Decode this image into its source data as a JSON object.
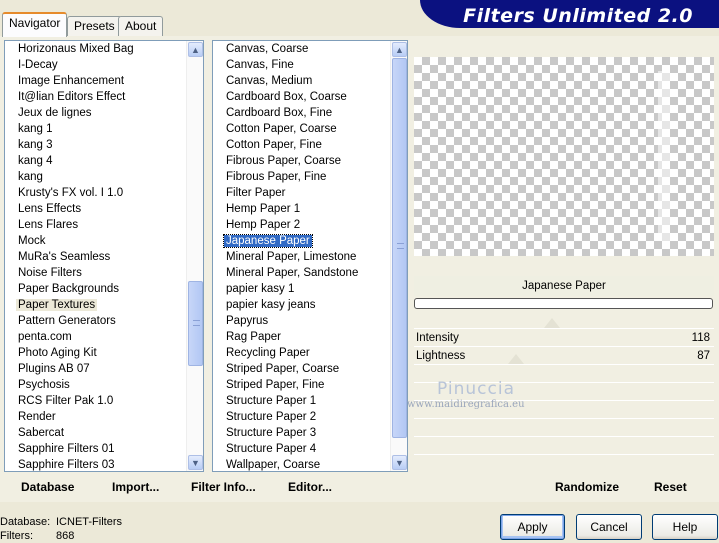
{
  "tabs": [
    "Navigator",
    "Presets",
    "About"
  ],
  "banner_title": "Filters Unlimited 2.0",
  "categories": [
    "Horizonaus Mixed Bag",
    "I-Decay",
    "Image Enhancement",
    "It@lian Editors Effect",
    "Jeux de lignes",
    "kang 1",
    "kang 3",
    "kang 4",
    "kang",
    "Krusty's FX vol. I 1.0",
    "Lens Effects",
    "Lens Flares",
    "Mock",
    "MuRa's Seamless",
    "Noise Filters",
    "Paper Backgrounds",
    "Paper Textures",
    "Pattern Generators",
    "penta.com",
    "Photo Aging Kit",
    "Plugins AB 07",
    "Psychosis",
    "RCS Filter Pak 1.0",
    "Render",
    "Sabercat",
    "Sapphire Filters 01",
    "Sapphire Filters 03"
  ],
  "selected_category": "Paper Textures",
  "filters": [
    "Canvas, Coarse",
    "Canvas, Fine",
    "Canvas, Medium",
    "Cardboard Box, Coarse",
    "Cardboard Box, Fine",
    "Cotton Paper, Coarse",
    "Cotton Paper, Fine",
    "Fibrous Paper, Coarse",
    "Fibrous Paper, Fine",
    "Filter Paper",
    "Hemp Paper 1",
    "Hemp Paper 2",
    "Japanese Paper",
    "Mineral Paper, Limestone",
    "Mineral Paper, Sandstone",
    "papier kasy 1",
    "papier kasy jeans",
    "Papyrus",
    "Rag Paper",
    "Recycling Paper",
    "Striped Paper, Coarse",
    "Striped Paper, Fine",
    "Structure Paper 1",
    "Structure Paper 2",
    "Structure Paper 3",
    "Structure Paper 4",
    "Wallpaper, Coarse"
  ],
  "selected_filter": "Japanese Paper",
  "preview_filter_name": "Japanese Paper",
  "sliders": [
    {
      "label": "Intensity",
      "value": "118"
    },
    {
      "label": "Lightness",
      "value": "87"
    }
  ],
  "watermark": {
    "line1": "Pinuccia",
    "line2": "www.maidiregrafica.eu"
  },
  "bottom_buttons": {
    "database": "Database",
    "import": "Import...",
    "filter_info": "Filter Info...",
    "editor": "Editor...",
    "randomize": "Randomize",
    "reset": "Reset"
  },
  "status": {
    "database_label": "Database:",
    "database_value": "ICNET-Filters",
    "filters_label": "Filters:",
    "filters_value": "868"
  },
  "dialog_buttons": {
    "apply": "Apply",
    "cancel": "Cancel",
    "help": "Help"
  },
  "icons": {
    "scroll_up": "▲",
    "scroll_down": "▼"
  }
}
